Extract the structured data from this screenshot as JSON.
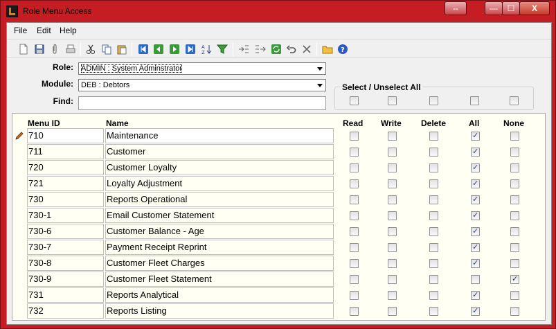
{
  "window": {
    "title": "Role Menu Access",
    "buttons": {
      "restore": "⇔",
      "minimize": "—",
      "maximize": "☐",
      "close": "X"
    }
  },
  "menu": [
    "File",
    "Edit",
    "Help"
  ],
  "toolbar": {
    "icons": [
      "new-doc-icon",
      "save-icon",
      "attach-icon",
      "print-icon",
      "cut-icon",
      "copy-icon",
      "paste-icon",
      "first-record-icon",
      "previous-record-icon",
      "next-record-icon",
      "last-record-icon",
      "sort-az-icon",
      "filter-icon",
      "indent-icon",
      "outdent-icon",
      "refresh-icon",
      "undo-icon",
      "delete-icon",
      "open-folder-icon",
      "help-icon"
    ]
  },
  "form": {
    "role_label": "Role:",
    "role_value": "ADMIN   :   System Adminstrator",
    "module_label": "Module:",
    "module_value": "DEB   :   Debtors",
    "find_label": "Find:",
    "find_value": "",
    "select_all_label": "Select / Unselect All"
  },
  "columns": {
    "menu_id": "Menu ID",
    "name": "Name",
    "read": "Read",
    "write": "Write",
    "delete": "Delete",
    "all": "All",
    "none": "None"
  },
  "rows": [
    {
      "id": "710",
      "name": "Maintenance",
      "read": false,
      "write": false,
      "delete": false,
      "all": true,
      "none": false
    },
    {
      "id": "711",
      "name": "Customer",
      "read": false,
      "write": false,
      "delete": false,
      "all": true,
      "none": false
    },
    {
      "id": "720",
      "name": "Customer Loyalty",
      "read": false,
      "write": false,
      "delete": false,
      "all": true,
      "none": false
    },
    {
      "id": "721",
      "name": "Loyalty Adjustment",
      "read": false,
      "write": false,
      "delete": false,
      "all": true,
      "none": false
    },
    {
      "id": "730",
      "name": "Reports Operational",
      "read": false,
      "write": false,
      "delete": false,
      "all": true,
      "none": false
    },
    {
      "id": "730-1",
      "name": "Email Customer Statement",
      "read": false,
      "write": false,
      "delete": false,
      "all": true,
      "none": false
    },
    {
      "id": "730-6",
      "name": "Customer Balance - Age",
      "read": false,
      "write": false,
      "delete": false,
      "all": true,
      "none": false
    },
    {
      "id": "730-7",
      "name": "Payment Receipt Reprint",
      "read": false,
      "write": false,
      "delete": false,
      "all": true,
      "none": false
    },
    {
      "id": "730-8",
      "name": "Customer Fleet Charges",
      "read": false,
      "write": false,
      "delete": false,
      "all": true,
      "none": false
    },
    {
      "id": "730-9",
      "name": "Customer Fleet Statement",
      "read": false,
      "write": false,
      "delete": false,
      "all": false,
      "none": true
    },
    {
      "id": "731",
      "name": "Reports Analytical",
      "read": false,
      "write": false,
      "delete": false,
      "all": true,
      "none": false
    },
    {
      "id": "732",
      "name": "Reports Listing",
      "read": false,
      "write": false,
      "delete": false,
      "all": true,
      "none": false
    }
  ],
  "colors": {
    "frame": "#c41e24",
    "grid_bg": "#fffff4",
    "check": "#2a3a6a"
  }
}
